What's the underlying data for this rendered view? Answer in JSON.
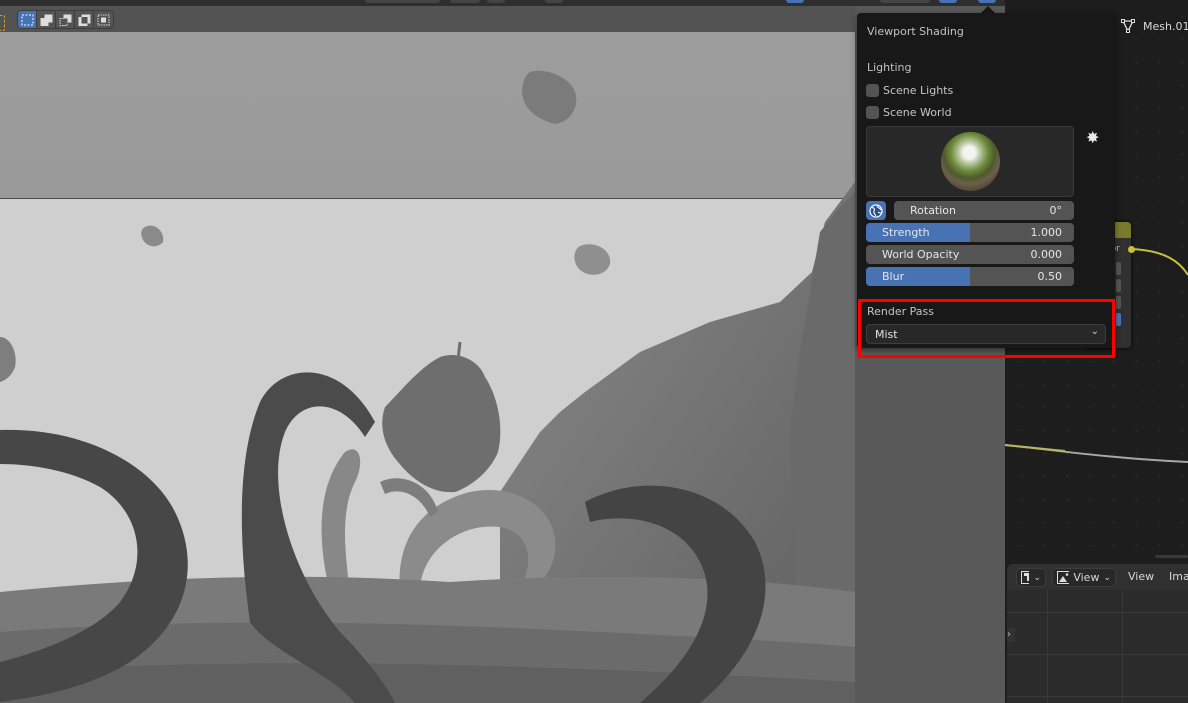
{
  "viewport": {
    "select_modes": [
      {
        "name": "set",
        "active": true
      },
      {
        "name": "extend",
        "active": false
      },
      {
        "name": "subtract",
        "active": false
      },
      {
        "name": "difference",
        "active": false
      },
      {
        "name": "intersect",
        "active": false
      }
    ]
  },
  "popover": {
    "title": "Viewport Shading",
    "lighting_label": "Lighting",
    "scene_lights": {
      "label": "Scene Lights",
      "checked": false
    },
    "scene_world": {
      "label": "Scene World",
      "checked": false
    },
    "hdri_icon": "hdri-sphere",
    "settings_icon": "gear-icon",
    "world_space_icon": "world-icon",
    "rotation": {
      "label": "Rotation",
      "value": "0°"
    },
    "strength": {
      "label": "Strength",
      "value": "1.000",
      "fraction": 0.5
    },
    "world_opacity": {
      "label": "World Opacity",
      "value": "0.000",
      "fraction": 0
    },
    "blur": {
      "label": "Blur",
      "value": "0.50",
      "fraction": 0.5
    },
    "render_pass_label": "Render Pass",
    "render_pass_value": "Mist"
  },
  "node_editor": {
    "object_label": "Mesh.01",
    "node_socket_text": "or"
  },
  "image_editor": {
    "view_dropdown": "View",
    "menu_view": "View",
    "menu_image": "Ima",
    "sidebar_toggle": "›"
  },
  "colors": {
    "accent": "#4772b3",
    "highlight": "#ff0000",
    "node_wire": "#c8c23a"
  }
}
